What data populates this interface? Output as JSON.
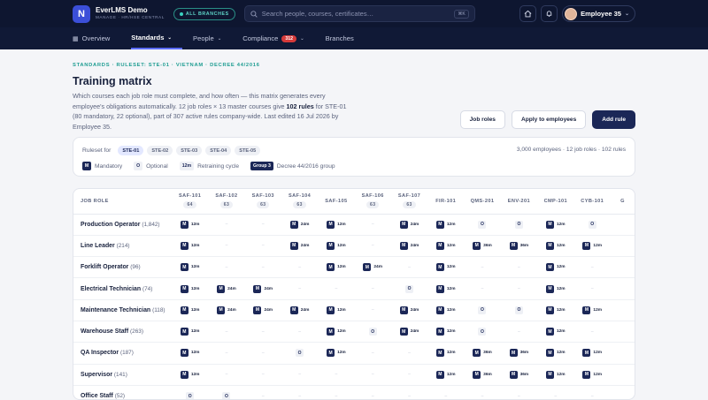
{
  "app": {
    "logo_letter": "N",
    "name": "EverLMS Demo",
    "subtitle": "MANAGE · HR/HSE CENTRAL",
    "scope_chip": "ALL BRANCHES"
  },
  "search": {
    "placeholder": "Search people, courses, certificates…",
    "shortcut": "⌘K"
  },
  "user": {
    "name": "Employee 35"
  },
  "nav": [
    {
      "label": "Overview",
      "icon": "▦"
    },
    {
      "label": "Standards",
      "icon": ""
    },
    {
      "label": "People",
      "icon": ""
    },
    {
      "label": "Compliance",
      "icon": "",
      "badge": "312"
    },
    {
      "label": "Branches",
      "icon": ""
    }
  ],
  "page": {
    "breadcrumb": "STANDARDS · RULESET: STE-01 · VIETNAM · DECREE 44/2016",
    "title": "Training matrix",
    "desc_part1": "Which courses each job role must complete, and how often — this matrix generates every employee's obligations automatically. 12 job roles × 13 master courses give ",
    "desc_bold1": "102 rules",
    "desc_part2": " for STE-01 (80 mandatory, 22 optional), part of 307 active rules company-wide. Last edited 16 Jul 2026 by Employee 35.",
    "btn_job_roles": "Job roles",
    "btn_apply": "Apply to employees",
    "btn_add_rule": "Add rule"
  },
  "ruleset": {
    "label": "Ruleset for",
    "chips": [
      "STE-01",
      "STE-02",
      "STE-03",
      "STE-04",
      "STE-05"
    ],
    "active": "STE-01",
    "stats": "3,000 employees · 12 job roles · 102 rules",
    "legend": {
      "m_key": "M",
      "m_label": "Mandatory",
      "o_key": "O",
      "o_label": "Optional",
      "r_key": "12m",
      "r_label": "Retraining cycle",
      "g_key": "Group 3",
      "g_label": "Decree 44/2016 group"
    }
  },
  "matrix": {
    "role_header": "JOB ROLE",
    "courses": [
      {
        "code": "SAF-101",
        "count": "64"
      },
      {
        "code": "SAF-102",
        "count": "63"
      },
      {
        "code": "SAF-103",
        "count": "63"
      },
      {
        "code": "SAF-104",
        "count": "63"
      },
      {
        "code": "SAF-105",
        "count": ""
      },
      {
        "code": "SAF-106",
        "count": "63"
      },
      {
        "code": "SAF-107",
        "count": "63"
      },
      {
        "code": "FIR-101",
        "count": ""
      },
      {
        "code": "QMS-201",
        "count": ""
      },
      {
        "code": "ENV-201",
        "count": ""
      },
      {
        "code": "CMP-101",
        "count": ""
      },
      {
        "code": "CYB-101",
        "count": ""
      },
      {
        "code": "G",
        "count": ""
      }
    ],
    "rows": [
      {
        "role": "Production Operator",
        "count": "(1,842)",
        "cells": [
          "M12m",
          "",
          "",
          "M24m",
          "M12m",
          "",
          "M24m",
          "M12m",
          "O",
          "O",
          "M12m",
          "O",
          ""
        ]
      },
      {
        "role": "Line Leader",
        "count": "(214)",
        "cells": [
          "M12m",
          "",
          "",
          "M24m",
          "M12m",
          "",
          "M24m",
          "M12m",
          "M36m",
          "M36m",
          "M12m",
          "M12m",
          ""
        ]
      },
      {
        "role": "Forklift Operator",
        "count": "(96)",
        "cells": [
          "M12m",
          "",
          "",
          "",
          "M12m",
          "M24m",
          "",
          "M12m",
          "",
          "",
          "M12m",
          "",
          ""
        ]
      },
      {
        "role": "Electrical Technician",
        "count": "(74)",
        "cells": [
          "M12m",
          "M24m",
          "M24m",
          "",
          "",
          "",
          "O",
          "M12m",
          "",
          "",
          "M12m",
          "",
          ""
        ]
      },
      {
        "role": "Maintenance Technician",
        "count": "(118)",
        "cells": [
          "M12m",
          "M24m",
          "M24m",
          "M24m",
          "M12m",
          "",
          "M24m",
          "M12m",
          "O",
          "O",
          "M12m",
          "M12m",
          ""
        ]
      },
      {
        "role": "Warehouse Staff",
        "count": "(263)",
        "cells": [
          "M12m",
          "",
          "",
          "",
          "M12m",
          "O",
          "M24m",
          "M12m",
          "O",
          "",
          "M12m",
          "",
          ""
        ]
      },
      {
        "role": "QA Inspector",
        "count": "(187)",
        "cells": [
          "M12m",
          "",
          "",
          "O",
          "M12m",
          "",
          "",
          "M12m",
          "M36m",
          "M36m",
          "M12m",
          "M12m",
          ""
        ]
      },
      {
        "role": "Supervisor",
        "count": "(141)",
        "cells": [
          "M12m",
          "",
          "",
          "",
          "",
          "",
          "",
          "M12m",
          "M36m",
          "M36m",
          "M12m",
          "M12m",
          ""
        ]
      },
      {
        "role": "Office Staff",
        "count": "(52)",
        "cells": [
          "O",
          "O",
          "",
          "",
          "",
          "",
          "",
          "",
          "",
          "",
          "",
          "",
          ""
        ]
      }
    ]
  }
}
